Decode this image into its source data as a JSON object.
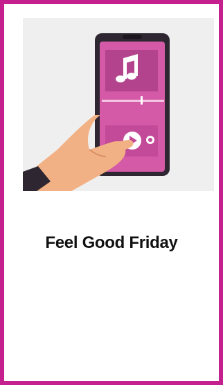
{
  "card": {
    "title": "Feel Good Friday",
    "border_color": "#c4218f",
    "illustration": {
      "subject": "hand-holding-phone-music-player",
      "icons": [
        "music-note-icon",
        "play-icon",
        "next-icon"
      ],
      "accent_color": "#d34fa6"
    }
  }
}
